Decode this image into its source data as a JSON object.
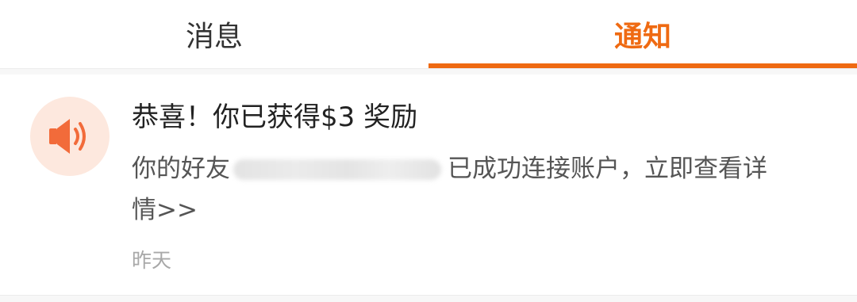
{
  "tabs": [
    {
      "label": "消息",
      "active": false
    },
    {
      "label": "通知",
      "active": true
    }
  ],
  "colors": {
    "accent": "#ef6a12",
    "icon_bg": "#fde8de",
    "icon": "#f26b3a"
  },
  "notification": {
    "icon": "speaker-icon",
    "title": "恭喜！你已获得$3 奖励",
    "body_prefix": "你的好友",
    "body_suffix": "已成功连接账户，立即查看详",
    "body_line2": "情>>",
    "timestamp": "昨天"
  }
}
